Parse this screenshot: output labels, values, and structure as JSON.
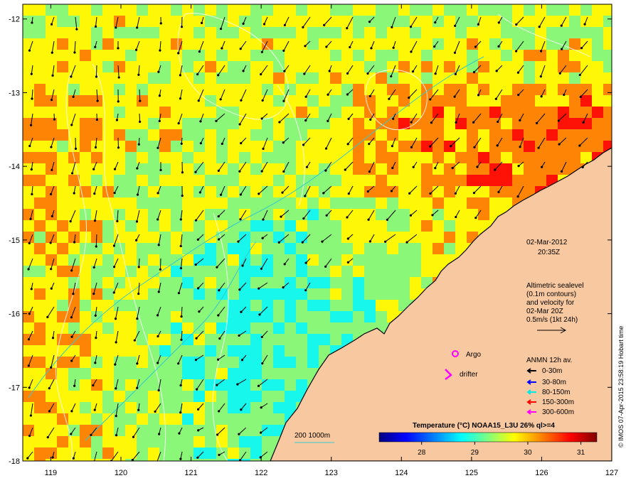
{
  "map": {
    "lon_ticks": [
      "119",
      "120",
      "121",
      "122",
      "123",
      "124",
      "125",
      "126",
      "127"
    ],
    "lat_ticks": [
      "-12",
      "-13",
      "-14",
      "-15",
      "-16",
      "-17",
      "-18"
    ],
    "lon_range": [
      118.6,
      127.0
    ],
    "lat_range": [
      -18.0,
      -11.8
    ]
  },
  "info": {
    "date": "02-Mar-2012",
    "time": "20:35Z",
    "alt_lines": [
      "Altimetric sealevel",
      "(0.1m contours)",
      "and velocity for",
      "02-Mar 20Z",
      "0.5m/s (1kt 24h)"
    ]
  },
  "legend": {
    "argo": "Argo",
    "drifter": "drifter",
    "anmn_title": "ANMN 12h av.",
    "depths": [
      {
        "label": "0-30m",
        "color": "#000000"
      },
      {
        "label": "30-80m",
        "color": "#0000ff"
      },
      {
        "label": "80-150m",
        "color": "#00e5e5"
      },
      {
        "label": "150-300m",
        "color": "#ff0000"
      },
      {
        "label": "300-600m",
        "color": "#ff00ff"
      }
    ]
  },
  "bathymetry": {
    "label": "200  1000m",
    "color": "#33cccc"
  },
  "colorbar": {
    "title": "Temperature (°C) NOAA15_L3U 26% ql>=4",
    "ticks": [
      "28",
      "29",
      "30",
      "31"
    ],
    "range": [
      27.2,
      31.3
    ],
    "colors": [
      "#00007f",
      "#0000ff",
      "#007fff",
      "#00ffff",
      "#7fff7f",
      "#ffff00",
      "#ff7f00",
      "#ff0000",
      "#7f0000"
    ]
  },
  "credit": "© IMOS 07-Apr-2015 23:58:19 Hobart time",
  "colors": {
    "land": "#f8c8a0",
    "no_data": "#e8e8e8"
  }
}
